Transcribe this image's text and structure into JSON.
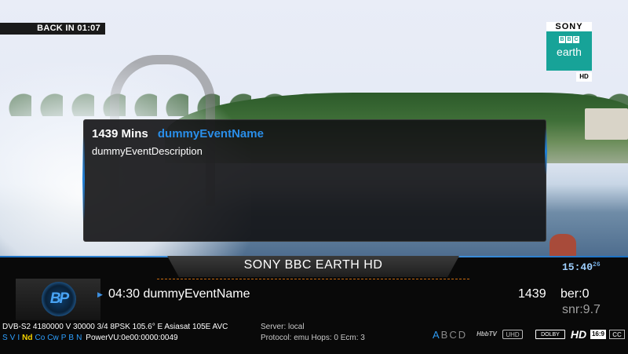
{
  "timeshift": {
    "back_in": "BACK IN 01:07"
  },
  "channel_logo": {
    "brand": "SONY",
    "bbc_letters": [
      "B",
      "B",
      "C"
    ],
    "sub": "earth",
    "hd": "HD",
    "color": "#17a398"
  },
  "info_panel": {
    "duration": "1439 Mins",
    "event_name": "dummyEventName",
    "description": "dummyEventDescription",
    "accent": "#2a8ee8"
  },
  "infobar": {
    "channel_name": "SONY BBC EARTH HD",
    "clock": "15:40",
    "clock_seconds": "26",
    "picon": {
      "text": "BP",
      "icon": "bp-picon-icon"
    },
    "event": {
      "time_and_name": "04:30 dummyEventName",
      "minutes": "1439",
      "ber": "ber:0",
      "snr": "snr:9.7"
    },
    "tuner_line": "DVB-S2  4180000  V  30000  3/4  8PSK  105.6° E  Asiasat 105E  AVC",
    "flags": [
      "S",
      "V",
      "I",
      "Nd",
      "Co",
      "Cw",
      "P",
      "B",
      "N"
    ],
    "powervu": "PowerVU:0e00:0000:0049",
    "server": "Server: local",
    "protocol": "Protocol: emu   Hops: 0   Ecm: 3",
    "sys_letters": [
      "A",
      "B",
      "C",
      "D"
    ],
    "icons": {
      "hbbtv": "HbbTV",
      "uhd": "UHD",
      "dolby": "DOLBY",
      "hd": "HD",
      "aspect": "16:9",
      "cc": "CC"
    }
  }
}
